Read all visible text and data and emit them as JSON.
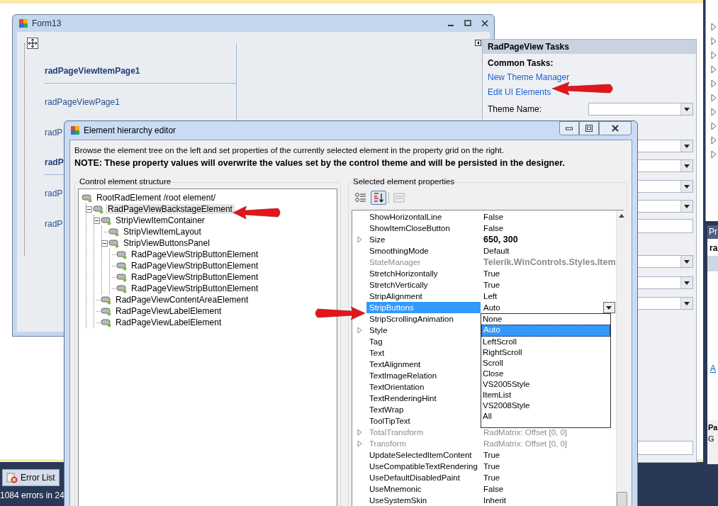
{
  "ide": {
    "error_tab": "Error List",
    "status": "1084 errors in 24"
  },
  "form": {
    "title": "Form13",
    "pages": [
      {
        "label": "radPageViewItemPage1",
        "kind": "header"
      },
      {
        "label": "radPageViewPage1",
        "kind": "page"
      },
      {
        "label": "radP",
        "kind": "page"
      },
      {
        "label": "radP",
        "kind": "header"
      },
      {
        "label": "radP",
        "kind": "page"
      },
      {
        "label": "radP",
        "kind": "page"
      }
    ]
  },
  "tasks": {
    "title": "RadPageView Tasks",
    "section": "Common Tasks:",
    "links": [
      "New Theme Manager",
      "Edit UI Elements"
    ],
    "theme_label": "Theme Name:"
  },
  "properties_window": {
    "title": "Pr",
    "object": "ra",
    "link": "A",
    "help_title": "Pa",
    "help_text": "G"
  },
  "dialog": {
    "title": "Element hierarchy editor",
    "description": "Browse the element tree on the left and set properties of the currently selected element in the property grid on the right.",
    "note": "NOTE: These property values will overwrite the values set by the control theme and will be persisted in the designer.",
    "tree_group": "Control element structure",
    "tree": [
      {
        "label": "RootRadElement /root element/",
        "selected": false,
        "children": [
          {
            "label": "RadPageViewBackstageElement",
            "selected": true,
            "expanded": true,
            "children": [
              {
                "label": "StripViewItemContainer",
                "selected": false,
                "expanded": true,
                "children": [
                  {
                    "label": "StripViewItemLayout",
                    "selected": false
                  },
                  {
                    "label": "StripViewButtonsPanel",
                    "selected": false,
                    "expanded": true,
                    "children": [
                      {
                        "label": "RadPageViewStripButtonElement",
                        "selected": false
                      },
                      {
                        "label": "RadPageViewStripButtonElement",
                        "selected": false
                      },
                      {
                        "label": "RadPageViewStripButtonElement",
                        "selected": false
                      },
                      {
                        "label": "RadPageViewStripButtonElement",
                        "selected": false
                      }
                    ]
                  }
                ]
              },
              {
                "label": "RadPageViewContentAreaElement",
                "selected": false
              },
              {
                "label": "RadPageViewLabelElement",
                "selected": false
              },
              {
                "label": "RadPageViewLabelElement",
                "selected": false
              }
            ]
          }
        ]
      }
    ],
    "props_group": "Selected element properties",
    "toolbar": [
      {
        "kind": "categorized",
        "selected": false,
        "disabled": false
      },
      {
        "kind": "alphabetical",
        "selected": true,
        "disabled": false
      },
      {
        "kind": "pages",
        "selected": false,
        "disabled": true
      }
    ],
    "properties": [
      {
        "name": "ShowHorizontalLine",
        "value": "False",
        "kind": "text",
        "expandable": false,
        "disabled": false,
        "modified": false,
        "selected": false
      },
      {
        "name": "ShowItemCloseButton",
        "value": "False",
        "kind": "text",
        "expandable": false,
        "disabled": false,
        "modified": false,
        "selected": false
      },
      {
        "name": "Size",
        "value": "650, 300",
        "kind": "text",
        "expandable": true,
        "disabled": false,
        "modified": true,
        "selected": false
      },
      {
        "name": "SmoothingMode",
        "value": "Default",
        "kind": "text",
        "expandable": false,
        "disabled": false,
        "modified": false,
        "selected": false
      },
      {
        "name": "StateManager",
        "value": "Telerik.WinControls.Styles.Item",
        "kind": "text",
        "expandable": false,
        "disabled": true,
        "modified": true,
        "selected": false
      },
      {
        "name": "StretchHorizontally",
        "value": "True",
        "kind": "text",
        "expandable": false,
        "disabled": false,
        "modified": false,
        "selected": false
      },
      {
        "name": "StretchVertically",
        "value": "True",
        "kind": "text",
        "expandable": false,
        "disabled": false,
        "modified": false,
        "selected": false
      },
      {
        "name": "StripAlignment",
        "value": "Left",
        "kind": "text",
        "expandable": false,
        "disabled": false,
        "modified": false,
        "selected": false
      },
      {
        "name": "StripButtons",
        "value": "Auto",
        "kind": "dropdown",
        "expandable": false,
        "disabled": false,
        "modified": false,
        "selected": true
      },
      {
        "name": "StripScrollingAnimation",
        "kind": "text",
        "expandable": false,
        "disabled": false,
        "selected": false
      },
      {
        "name": "Style",
        "kind": "text",
        "expandable": true,
        "disabled": false,
        "selected": false
      },
      {
        "name": "Tag",
        "kind": "text",
        "expandable": false,
        "disabled": false,
        "selected": false
      },
      {
        "name": "Text",
        "kind": "text",
        "expandable": false,
        "disabled": false,
        "selected": false
      },
      {
        "name": "TextAlignment",
        "kind": "text",
        "expandable": false,
        "disabled": false,
        "selected": false
      },
      {
        "name": "TextImageRelation",
        "kind": "text",
        "expandable": false,
        "disabled": false,
        "selected": false
      },
      {
        "name": "TextOrientation",
        "kind": "text",
        "expandable": false,
        "disabled": false,
        "selected": false
      },
      {
        "name": "TextRenderingHint",
        "kind": "text",
        "expandable": false,
        "disabled": false,
        "selected": false
      },
      {
        "name": "TextWrap",
        "kind": "text",
        "expandable": false,
        "disabled": false,
        "selected": false
      },
      {
        "name": "ToolTipText",
        "kind": "text",
        "expandable": false,
        "disabled": false,
        "selected": false
      },
      {
        "name": "TotalTransform",
        "value": "RadMatrix: Offset [0, 0]",
        "kind": "text",
        "expandable": true,
        "disabled": true,
        "modified": false,
        "selected": false
      },
      {
        "name": "Transform",
        "value": "RadMatrix: Offset [0, 0]",
        "kind": "text",
        "expandable": true,
        "disabled": true,
        "modified": false,
        "selected": false
      },
      {
        "name": "UpdateSelectedItemContent",
        "value": "True",
        "kind": "text",
        "expandable": false,
        "disabled": false,
        "modified": false,
        "selected": false
      },
      {
        "name": "UseCompatibleTextRendering",
        "value": "True",
        "kind": "text",
        "expandable": false,
        "disabled": false,
        "modified": false,
        "selected": false
      },
      {
        "name": "UseDefaultDisabledPaint",
        "value": "True",
        "kind": "text",
        "expandable": false,
        "disabled": false,
        "modified": false,
        "selected": false
      },
      {
        "name": "UseMnemonic",
        "value": "False",
        "kind": "text",
        "expandable": false,
        "disabled": false,
        "modified": false,
        "selected": false
      },
      {
        "name": "UseSystemSkin",
        "value": "Inherit",
        "kind": "text",
        "expandable": false,
        "disabled": false,
        "modified": false,
        "selected": false
      }
    ],
    "dropdown": {
      "options": [
        {
          "label": "None",
          "selected": false
        },
        {
          "label": "Auto",
          "selected": true
        },
        {
          "label": "LeftScroll",
          "selected": false
        },
        {
          "label": "RightScroll",
          "selected": false
        },
        {
          "label": "Scroll",
          "selected": false
        },
        {
          "label": "Close",
          "selected": false
        },
        {
          "label": "VS2005Style",
          "selected": false
        },
        {
          "label": "ItemList",
          "selected": false
        },
        {
          "label": "VS2008Style",
          "selected": false
        },
        {
          "label": "All",
          "selected": false
        }
      ]
    }
  }
}
